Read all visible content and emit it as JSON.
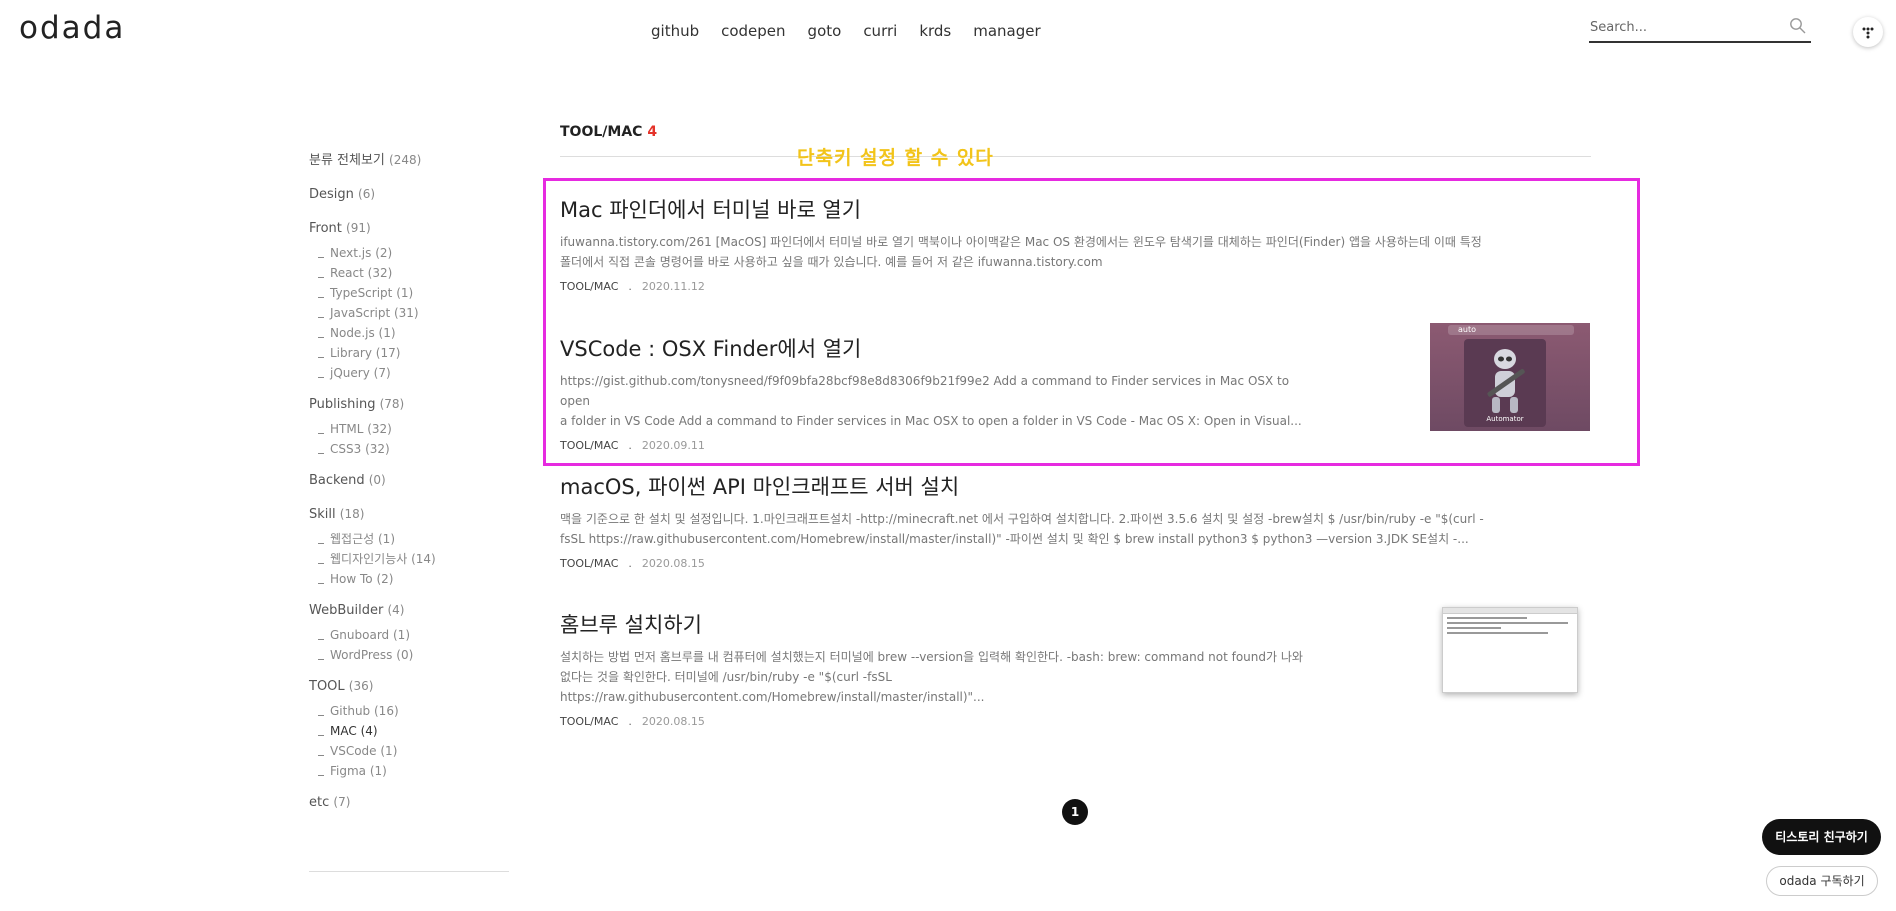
{
  "header": {
    "logo": "odada",
    "nav": [
      "github",
      "codepen",
      "goto",
      "curri",
      "krds",
      "manager"
    ],
    "search_placeholder": "Search..."
  },
  "sidebar": {
    "all": {
      "label": "분류 전체보기",
      "count": "(248)"
    },
    "groups": [
      {
        "label": "Design",
        "count": "(6)",
        "items": []
      },
      {
        "label": "Front",
        "count": "(91)",
        "items": [
          {
            "label": "Next.js",
            "count": "(2)"
          },
          {
            "label": "React",
            "count": "(32)"
          },
          {
            "label": "TypeScript",
            "count": "(1)"
          },
          {
            "label": "JavaScript",
            "count": "(31)"
          },
          {
            "label": "Node.js",
            "count": "(1)"
          },
          {
            "label": "Library",
            "count": "(17)"
          },
          {
            "label": "jQuery",
            "count": "(7)"
          }
        ]
      },
      {
        "label": "Publishing",
        "count": "(78)",
        "items": [
          {
            "label": "HTML",
            "count": "(32)"
          },
          {
            "label": "CSS3",
            "count": "(32)"
          }
        ]
      },
      {
        "label": "Backend",
        "count": "(0)",
        "items": []
      },
      {
        "label": "Skill",
        "count": "(18)",
        "items": [
          {
            "label": "웹접근성",
            "count": "(1)"
          },
          {
            "label": "웹디자인기능사",
            "count": "(14)"
          },
          {
            "label": "How To",
            "count": "(2)"
          }
        ]
      },
      {
        "label": "WebBuilder",
        "count": "(4)",
        "items": [
          {
            "label": "Gnuboard",
            "count": "(1)"
          },
          {
            "label": "WordPress",
            "count": "(0)"
          }
        ]
      },
      {
        "label": "TOOL",
        "count": "(36)",
        "items": [
          {
            "label": "Github",
            "count": "(16)"
          },
          {
            "label": "MAC",
            "count": "(4)"
          },
          {
            "label": "VSCode",
            "count": "(1)"
          },
          {
            "label": "Figma",
            "count": "(1)"
          }
        ]
      },
      {
        "label": "etc",
        "count": "(7)",
        "items": []
      }
    ]
  },
  "main": {
    "category_title": "TOOL/MAC",
    "category_count": "4",
    "annotation": "단축키 설정 할 수 있다",
    "posts": [
      {
        "title": "Mac 파인더에서 터미널 바로 열기",
        "excerpt_line1": "ifuwanna.tistory.com/261 [MacOS] 파인더에서 터미널 바로 열기 맥북이나 아이맥같은 Mac OS 환경에서는 윈도우 탐색기를 대체하는 파인더(Finder) 앱을 사용하는데 이때 특정",
        "excerpt_line2": "폴더에서 직접 콘솔 명령어를 바로 사용하고 싶을 때가 있습니다. 예를 들어 저 같은 ifuwanna.tistory.com",
        "category": "TOOL/MAC",
        "date": "2020.11.12"
      },
      {
        "title": "VSCode : OSX Finder에서 열기",
        "excerpt_line1": "https://gist.github.com/tonysneed/f9f09bfa28bcf98e8d8306f9b21f99e2 Add a command to Finder services in Mac OSX to open",
        "excerpt_line2": "a folder in VS Code Add a command to Finder services in Mac OSX to open a folder in VS Code - Mac OS X: Open in Visual...",
        "category": "TOOL/MAC",
        "date": "2020.09.11",
        "thumb_search_text": "auto",
        "thumb_label": "Automator"
      },
      {
        "title": "macOS, 파이썬 API 마인크래프트 서버 설치",
        "excerpt_line1": "맥을 기준으로 한 설치 및 설정입니다. 1.마인크래프트설치 -http://minecraft.net 에서 구입하여 설치합니다. 2.파이썬 3.5.6 설치 및 설정 -brew설치 $ /usr/bin/ruby -e \"$(curl -",
        "excerpt_line2": "fsSL https://raw.githubusercontent.com/Homebrew/install/master/install)\" -파이썬 설치 및 확인 $ brew install python3 $ python3 —version 3.JDK SE설치 -...",
        "category": "TOOL/MAC",
        "date": "2020.08.15"
      },
      {
        "title": "홈브루 설치하기",
        "excerpt_line1": "설치하는 방법 먼저 홈브루를 내 컴퓨터에 설치했는지 터미널에 brew --version을 입력해 확인한다. -bash: brew: command not found가 나와",
        "excerpt_line2": "없다는 것을 확인한다. 터미널에 /usr/bin/ruby -e \"$(curl -fsSL https://raw.githubusercontent.com/Homebrew/install/master/install)\"...",
        "category": "TOOL/MAC",
        "date": "2020.08.15"
      }
    ],
    "page": "1"
  },
  "floating": {
    "friend": "티스토리 친구하기",
    "subscribe": "odada 구독하기"
  }
}
